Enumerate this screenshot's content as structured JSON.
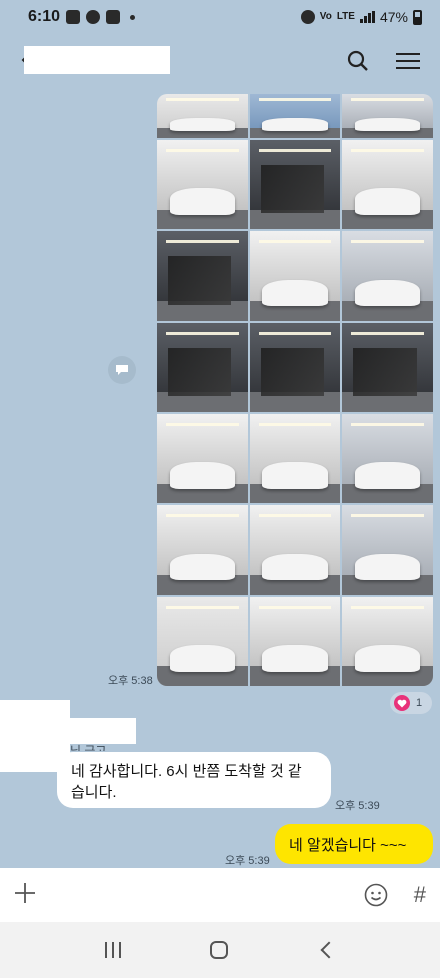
{
  "status_bar": {
    "time": "6:10",
    "network_label": "LTE",
    "network_sub": "4G",
    "volte_label": "Vo",
    "battery": "47%"
  },
  "chat": {
    "messages": [
      {
        "type": "photo_album",
        "direction": "outgoing",
        "time": "오후 5:38",
        "reaction_count": "1"
      },
      {
        "type": "text",
        "direction": "incoming",
        "sender": "님 금고",
        "text_line1": "네 감사합니다. 6시 반쯤 도착할 것 같",
        "text_line2": "습니다.",
        "time": "오후 5:39"
      },
      {
        "type": "text",
        "direction": "outgoing",
        "text": "네 알겠습니다 ~~~",
        "time": "오후 5:39"
      }
    ]
  },
  "photo_tiles": [
    {
      "bg": "bg-a"
    },
    {
      "bg": "bg-blue"
    },
    {
      "bg": "bg-b"
    },
    {
      "bg": "bg-c"
    },
    {
      "bg": "bg-d"
    },
    {
      "bg": "bg-c"
    },
    {
      "bg": "bg-d"
    },
    {
      "bg": "bg-c"
    },
    {
      "bg": "bg-b"
    },
    {
      "bg": "bg-d"
    },
    {
      "bg": "bg-d"
    },
    {
      "bg": "bg-d"
    },
    {
      "bg": "bg-c"
    },
    {
      "bg": "bg-c"
    },
    {
      "bg": "bg-b"
    },
    {
      "bg": "bg-c"
    },
    {
      "bg": "bg-c"
    },
    {
      "bg": "bg-b"
    },
    {
      "bg": "bg-a"
    },
    {
      "bg": "bg-c"
    },
    {
      "bg": "bg-c"
    }
  ],
  "input_bar": {
    "hash_label": "#"
  },
  "colors": {
    "chat_background": "#b2c7d9",
    "outgoing_bubble": "#fee500",
    "incoming_bubble": "#ffffff",
    "reaction_heart": "#e8327a"
  },
  "icons": [
    "back-arrow-icon",
    "search-icon",
    "menu-icon",
    "share-icon",
    "heart-icon",
    "plus-icon",
    "emoji-icon",
    "hash-icon",
    "recents-icon",
    "home-icon",
    "nav-back-icon"
  ]
}
